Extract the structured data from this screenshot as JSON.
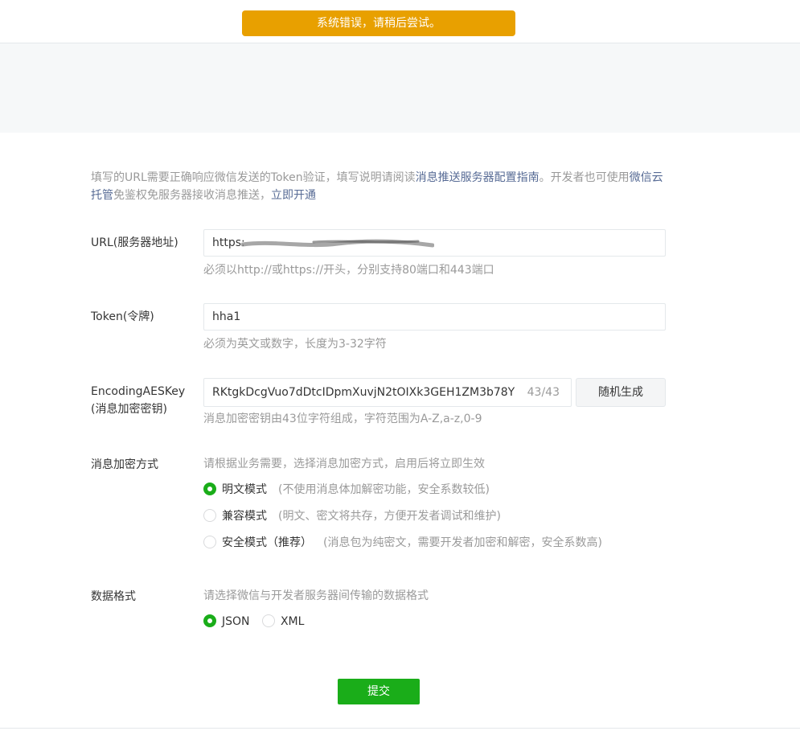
{
  "toast": "系统错误，请稍后尝试。",
  "intro": {
    "prefix": "填写的URL需要正确响应微信发送的Token验证，填写说明请阅读",
    "guide_link": "消息推送服务器配置指南",
    "middle": "。开发者也可使用",
    "cloud_link": "微信云托管",
    "suffix": "免鉴权免服务器接收消息推送，",
    "open_link": "立即开通"
  },
  "url": {
    "label": "URL(服务器地址)",
    "value": "https:",
    "tip": "必须以http://或https://开头，分别支持80端口和443端口"
  },
  "token": {
    "label": "Token(令牌)",
    "value": "hha1",
    "tip": "必须为英文或数字，长度为3-32字符"
  },
  "aeskey": {
    "label_line1": "EncodingAESKey",
    "label_line2": "(消息加密密钥)",
    "value": "RKtgkDcgVuo7dDtcIDpmXuvjN2tOIXk3GEH1ZM3b78Y",
    "counter": "43/43",
    "random_button": "随机生成",
    "tip": "消息加密密钥由43位字符组成，字符范围为A-Z,a-z,0-9"
  },
  "encryption": {
    "label": "消息加密方式",
    "tip": "请根据业务需要，选择消息加密方式，启用后将立即生效",
    "options": [
      {
        "label": "明文模式",
        "desc": "(不使用消息体加解密功能，安全系数较低)",
        "checked": true
      },
      {
        "label": "兼容模式",
        "desc": "(明文、密文将共存，方便开发者调试和维护)",
        "checked": false
      },
      {
        "label": "安全模式（推荐）",
        "desc": "(消息包为纯密文，需要开发者加密和解密，安全系数高)",
        "checked": false
      }
    ]
  },
  "format": {
    "label": "数据格式",
    "tip": "请选择微信与开发者服务器间传输的数据格式",
    "options": [
      {
        "label": "JSON",
        "checked": true
      },
      {
        "label": "XML",
        "checked": false
      }
    ]
  },
  "submit": "提交",
  "colors": {
    "primary": "#1aad19",
    "warning": "#e8a000",
    "link": "#576b95"
  }
}
